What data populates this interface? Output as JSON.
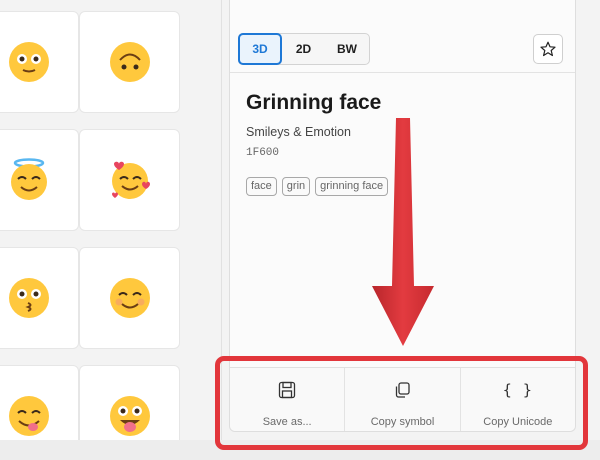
{
  "view_modes": {
    "mode_3d": "3D",
    "mode_2d": "2D",
    "mode_bw": "BW",
    "selected": "3D"
  },
  "detail": {
    "name": "Grinning face",
    "category": "Smileys & Emotion",
    "code": "1F600",
    "tags": [
      "face",
      "grin",
      "grinning face"
    ]
  },
  "actions": {
    "save_label": "Save as...",
    "copy_symbol_label": "Copy symbol",
    "copy_unicode_label": "Copy Unicode",
    "copy_unicode_icon_glyph": "{ }"
  },
  "grid": {
    "tiles": [
      "wide-eyes-face",
      "upside-down-face",
      "halo-face",
      "smiling-hearts-face",
      "kissing-face",
      "smiling-face",
      "tongue-face",
      "zany-face"
    ]
  },
  "colors": {
    "accent": "#1e78d6",
    "annotation_red": "#e2363b",
    "emoji_yellow": "#ffc83d"
  }
}
